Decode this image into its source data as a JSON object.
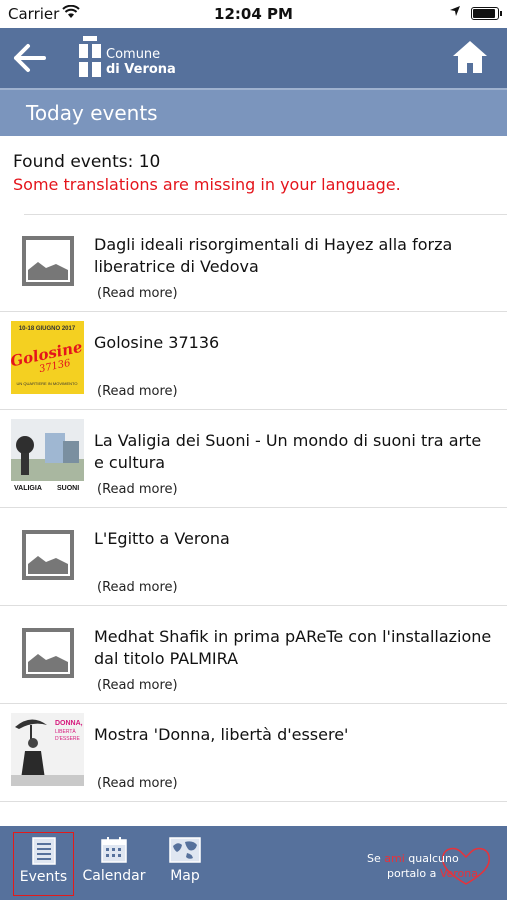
{
  "status_bar": {
    "carrier": "Carrier",
    "time": "12:04 PM",
    "battery_level": 0.95
  },
  "nav": {
    "logo_line1": "Comune",
    "logo_line2": "di Verona",
    "back_icon": "back-arrow-icon",
    "home_icon": "home-icon"
  },
  "section": {
    "title": "Today events"
  },
  "summary": {
    "found": "Found events: 10",
    "warning": "Some translations are missing in your language."
  },
  "events": [
    {
      "title": "Dagli ideali risorgimentali di Hayez alla forza liberatrice di Vedova",
      "more": "(Read more)",
      "image": "placeholder"
    },
    {
      "title": "Golosine 37136",
      "more": "(Read more)",
      "image": "golosine",
      "poster_date": "10-18 GIUGNO 2017",
      "poster_title": "Golosine",
      "poster_number": "37136",
      "poster_sub": "UN QUARTIERE IN MOVIMENTO"
    },
    {
      "title": "La Valigia dei Suoni - Un mondo di suoni tra arte e cultura",
      "more": "(Read more)",
      "image": "valigia",
      "poster_text_left": "VALIGIA",
      "poster_text_right": "SUONI"
    },
    {
      "title": "L'Egitto a Verona",
      "more": "(Read more)",
      "image": "placeholder"
    },
    {
      "title": "Medhat Shafik in prima pAReTe con l'installazione dal titolo PALMIRA",
      "more": "(Read more)",
      "image": "placeholder"
    },
    {
      "title": "Mostra 'Donna, libertà d'essere'",
      "more": "(Read more)",
      "image": "donna",
      "poster_line1": "DONNA,",
      "poster_line2": "LIBERTÀ",
      "poster_line3": "D'ESSERE"
    }
  ],
  "tabs": [
    {
      "label": "Events",
      "icon": "events-list-icon",
      "active": true
    },
    {
      "label": "Calendar",
      "icon": "calendar-icon",
      "active": false
    },
    {
      "label": "Map",
      "icon": "map-icon",
      "active": false
    }
  ],
  "brand": {
    "pre": "Se ",
    "ami": "ami",
    "mid": " qualcuno",
    "pre2": "portalo a ",
    "verona": "Verona"
  },
  "colors": {
    "nav": "#56719c",
    "header": "#7b95bd",
    "warning": "#e4141b",
    "tab_active_border": "#e21b1b"
  }
}
